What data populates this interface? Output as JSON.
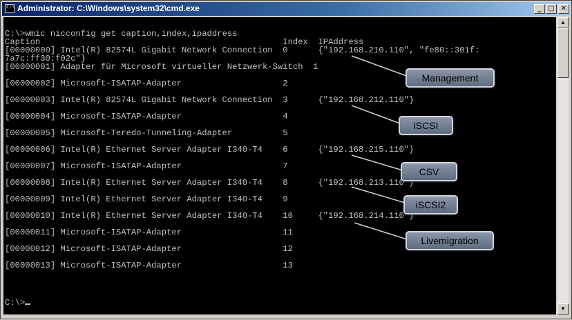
{
  "window": {
    "title": "Administrator: C:\\Windows\\system32\\cmd.exe"
  },
  "console": {
    "lines": [
      "",
      "C:\\>wmic nicconfig get caption,index,ipaddress",
      "Caption                                                Index  IPAddress",
      "[00000000] Intel(R) 82574L Gigabit Network Connection  0      {\"192.168.210.110\", \"fe80::301f:",
      "7a7c:ff30:f02c\"}",
      "[00000001] Adapter für Microsoft virtueller Netzwerk-Switch  1",
      "",
      "[00000002] Microsoft-ISATAP-Adapter                    2",
      "",
      "[00000003] Intel(R) 82574L Gigabit Network Connection  3      {\"192.168.212.110\"}",
      "",
      "[00000004] Microsoft-ISATAP-Adapter                    4",
      "",
      "[00000005] Microsoft-Teredo-Tunneling-Adapter          5",
      "",
      "[00000006] Intel(R) Ethernet Server Adapter I340-T4    6      {\"192.168.215.110\"}",
      "",
      "[00000007] Microsoft-ISATAP-Adapter                    7",
      "",
      "[00000008] Intel(R) Ethernet Server Adapter I340-T4    8      {\"192.168.213.110\"}",
      "",
      "[00000009] Intel(R) Ethernet Server Adapter I340-T4    9",
      "",
      "[00000010] Intel(R) Ethernet Server Adapter I340-T4    10     {\"192.168.214.110\"}",
      "",
      "[00000011] Microsoft-ISATAP-Adapter                    11",
      "",
      "[00000012] Microsoft-ISATAP-Adapter                    12",
      "",
      "[00000013] Microsoft-ISATAP-Adapter                    13",
      "",
      "",
      ""
    ],
    "prompt": "C:\\>"
  },
  "callouts": [
    "Management",
    "iSCSI",
    "CSV",
    "iSCSI2",
    "Livemigration"
  ],
  "titlebar_buttons": {
    "minimize": "_",
    "maximize": "□",
    "close": "✕"
  },
  "icons": {
    "console_icon": "console-window-icon",
    "scroll_up": "▲",
    "scroll_down": "▼"
  },
  "colors": {
    "titlebar": "#0a246a",
    "console_bg": "#000000",
    "console_fg": "#c0c0c0",
    "callout_bg": "#6b778a"
  }
}
